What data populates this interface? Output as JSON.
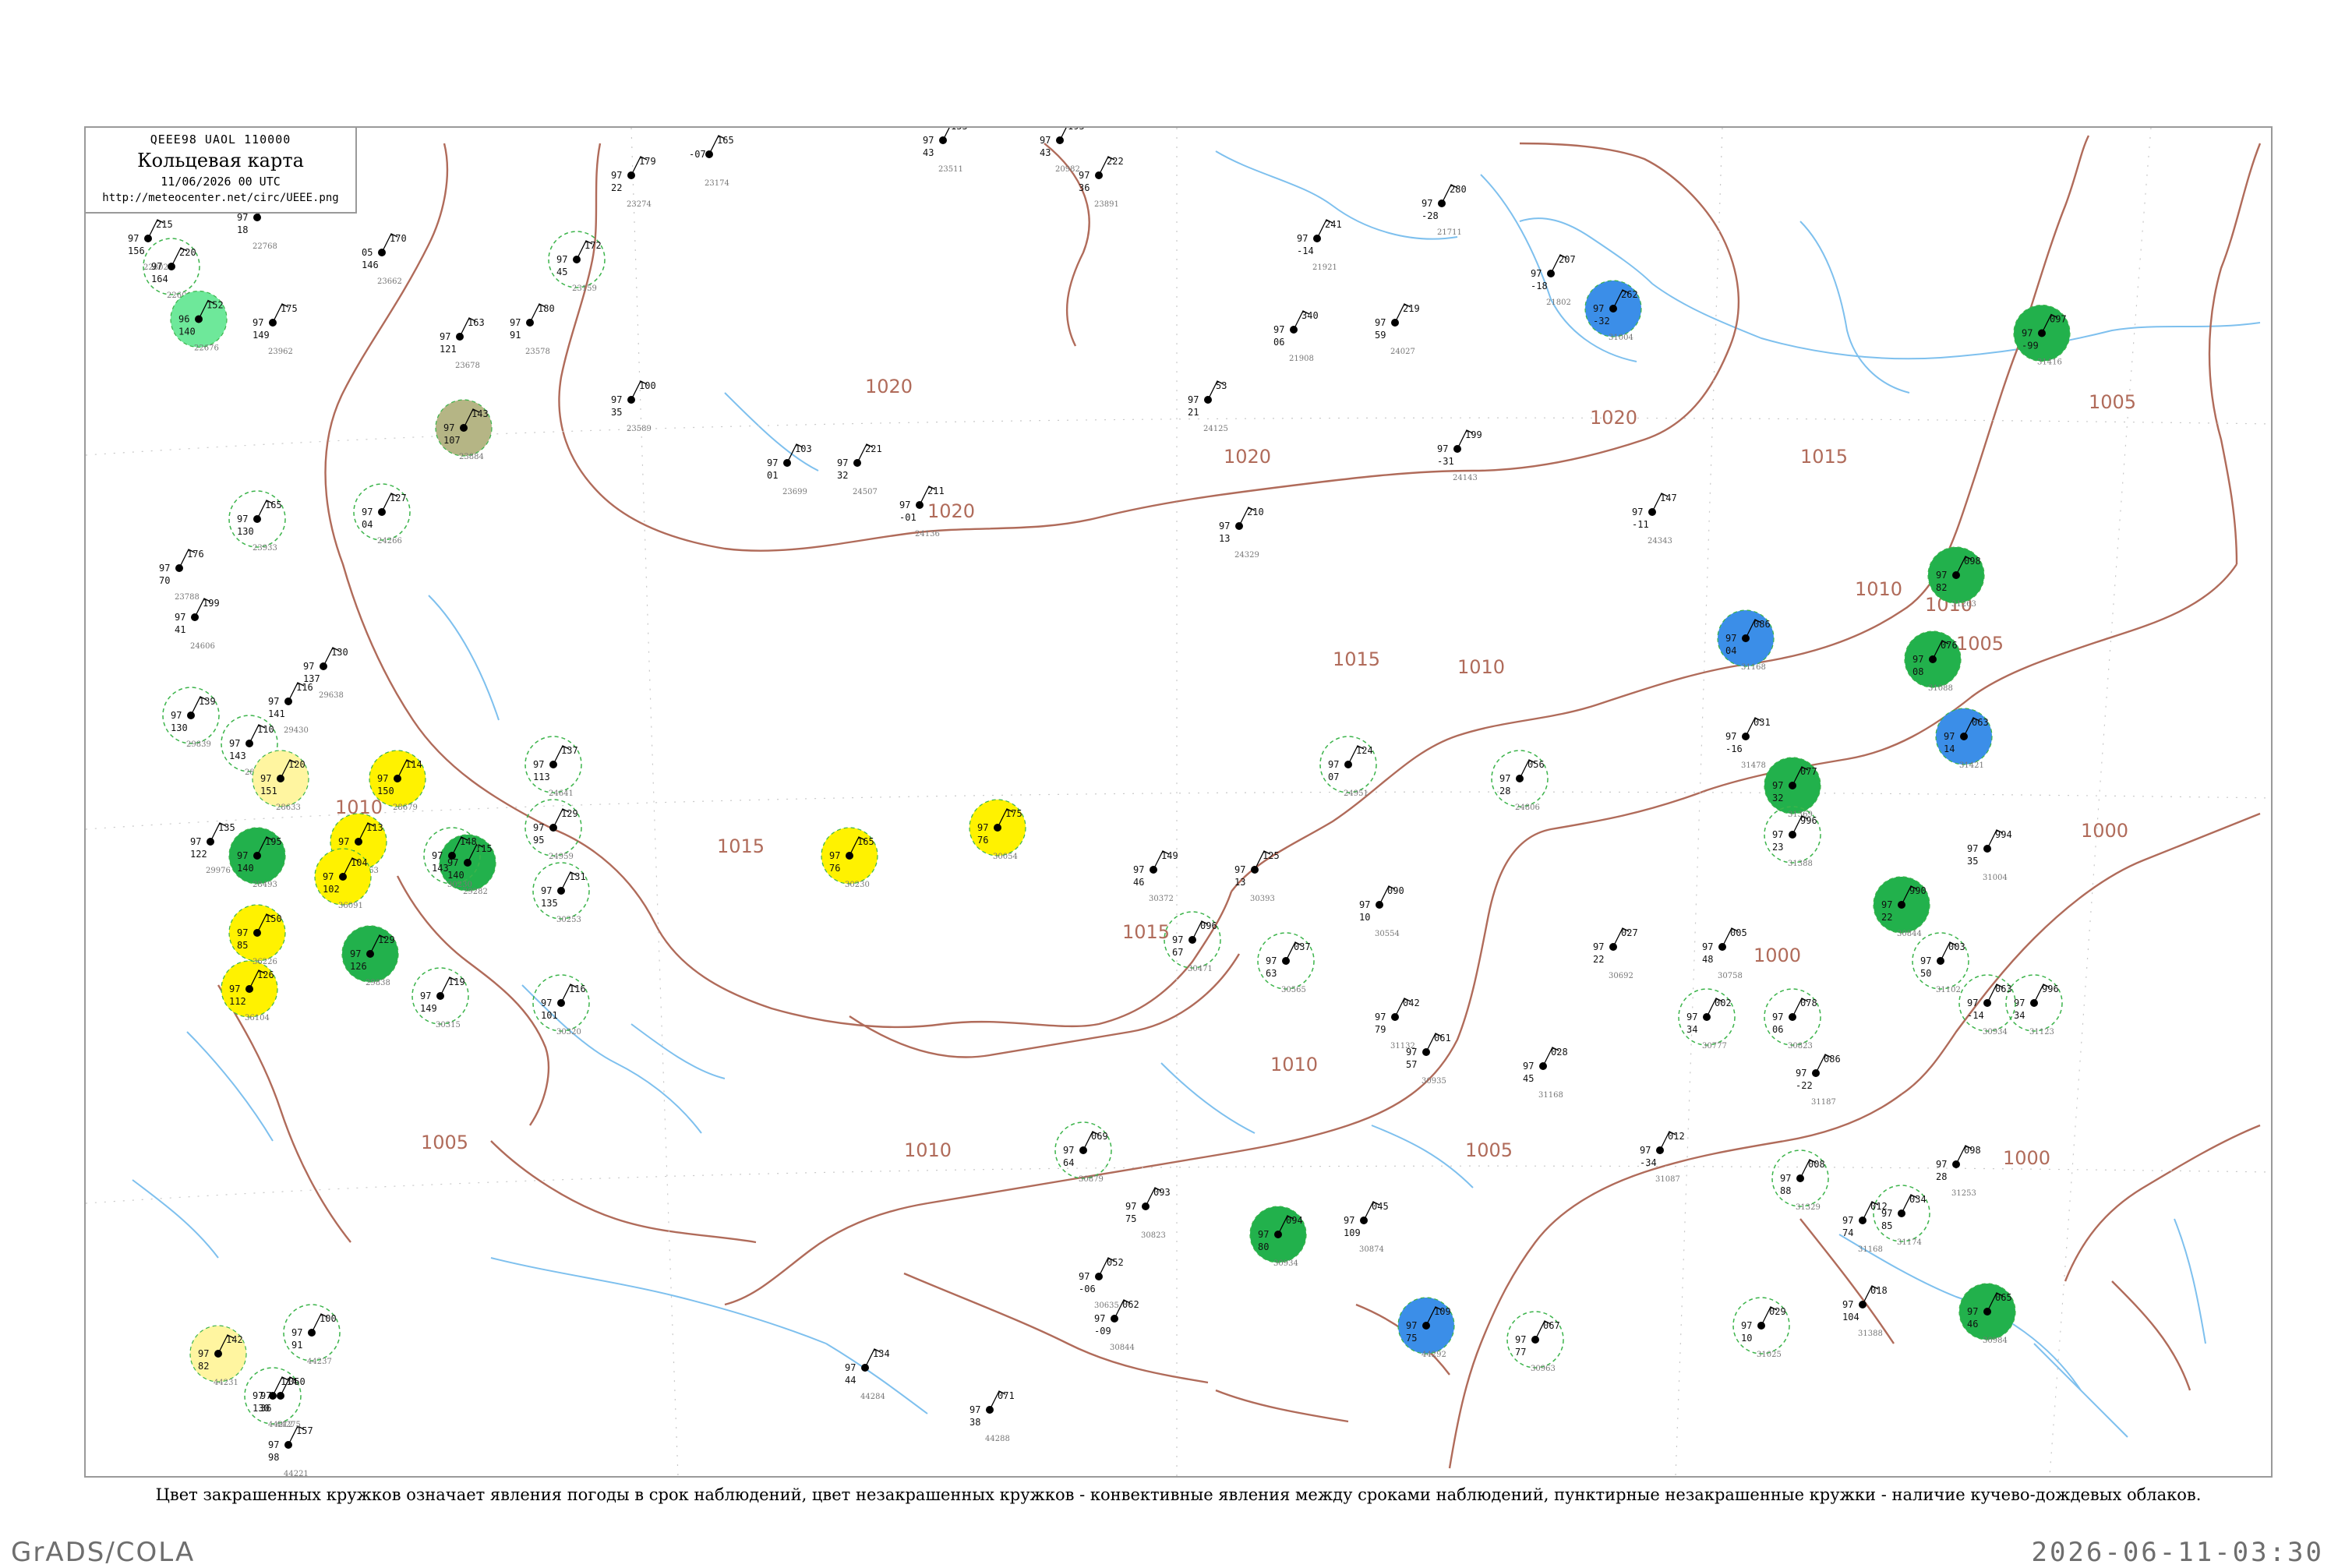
{
  "title_box": {
    "code": "QEEE98  UAOL  110000",
    "name": "Кольцевая карта",
    "time": "11/06/2026 00 UTC",
    "url": "http://meteocenter.net/circ/UEEE.png"
  },
  "caption": "Цвет закрашенных кружков означает явления погоды в срок наблюдений, цвет незакрашенных кружков - конвективные явления между сроками наблюдений, пунктирные незакрашенные кружки - наличие кучево-дождевых облаков.",
  "footer": {
    "left": "GrADS/COLA",
    "right": "2026-06-11-03:30"
  },
  "colors": {
    "isobar": "#b06b5a",
    "water": "#7ec0ee",
    "frame": "#9a9a9a",
    "green": "#22b14c",
    "light_green": "#6ee89a",
    "yellow": "#fff200",
    "pale_yellow": "#fff5a0",
    "blue": "#3b8ee8",
    "olive": "#b5b585",
    "dashed_ring": "#3cb44b"
  },
  "isobar_labels": [
    {
      "text": "1020"
    },
    {
      "text": "1020"
    },
    {
      "text": "1020"
    },
    {
      "text": "1020"
    },
    {
      "text": "1015"
    },
    {
      "text": "1015"
    },
    {
      "text": "1015"
    },
    {
      "text": "1015"
    },
    {
      "text": "1010"
    },
    {
      "text": "1010"
    },
    {
      "text": "1010"
    },
    {
      "text": "1010"
    },
    {
      "text": "1010"
    },
    {
      "text": "1010"
    },
    {
      "text": "1005"
    },
    {
      "text": "1005"
    },
    {
      "text": "1005"
    },
    {
      "text": "1000"
    },
    {
      "text": "1000"
    },
    {
      "text": "1000"
    },
    {
      "text": "1005"
    }
  ],
  "stations": [
    {
      "p": "155",
      "t": "97",
      "td": "43",
      "idx": "23511",
      "mark": "none"
    },
    {
      "p": "195",
      "t": "97",
      "td": "43",
      "idx": "20982",
      "mark": "none"
    },
    {
      "p": "165",
      "t": "-07",
      "td": "",
      "idx": "23174",
      "mark": "none"
    },
    {
      "p": "179",
      "t": "97",
      "td": "22",
      "idx": "23274",
      "mark": "none"
    },
    {
      "p": "222",
      "t": "97",
      "td": "36",
      "idx": "23891",
      "mark": "none"
    },
    {
      "p": "280",
      "t": "97",
      "td": "-28",
      "idx": "21711",
      "mark": "none"
    },
    {
      "p": "241",
      "t": "97",
      "td": "-14",
      "idx": "21921",
      "mark": "none"
    },
    {
      "p": "207",
      "t": "97",
      "td": "-18",
      "idx": "21802",
      "mark": "none"
    },
    {
      "p": "262",
      "t": "97",
      "td": "-32",
      "idx": "31004",
      "mark": "blue"
    },
    {
      "p": "206",
      "t": "97",
      "td": "18",
      "idx": "22768",
      "mark": "none"
    },
    {
      "p": "215",
      "t": "97",
      "td": "156",
      "idx": "22802",
      "mark": "none"
    },
    {
      "p": "220",
      "t": "97",
      "td": "164",
      "idx": "22601",
      "mark": "dashed"
    },
    {
      "p": "172",
      "t": "97",
      "td": "45",
      "idx": "23159",
      "mark": "dashed"
    },
    {
      "p": "170",
      "t": "05",
      "td": "146",
      "idx": "23662",
      "mark": "none"
    },
    {
      "p": "180",
      "t": "97",
      "td": "91",
      "idx": "23578",
      "mark": "none"
    },
    {
      "p": "163",
      "t": "97",
      "td": "121",
      "idx": "23678",
      "mark": "none"
    },
    {
      "p": "152",
      "t": "96",
      "td": "140",
      "idx": "22676",
      "mark": "light_green"
    },
    {
      "p": "175",
      "t": "97",
      "td": "149",
      "idx": "23962",
      "mark": "none"
    },
    {
      "p": "340",
      "t": "97",
      "td": "06",
      "idx": "21908",
      "mark": "none"
    },
    {
      "p": "219",
      "t": "97",
      "td": "59",
      "idx": "24027",
      "mark": "none"
    },
    {
      "p": "53",
      "t": "97",
      "td": "21",
      "idx": "24125",
      "mark": "none"
    },
    {
      "p": "199",
      "t": "97",
      "td": "-31",
      "idx": "24143",
      "mark": "none"
    },
    {
      "p": "143",
      "t": "97",
      "td": "107",
      "idx": "23884",
      "mark": "olive"
    },
    {
      "p": "100",
      "t": "97",
      "td": "35",
      "idx": "23589",
      "mark": "none"
    },
    {
      "p": "103",
      "t": "97",
      "td": "01",
      "idx": "23699",
      "mark": "none"
    },
    {
      "p": "221",
      "t": "97",
      "td": "32",
      "idx": "24507",
      "mark": "none"
    },
    {
      "p": "211",
      "t": "97",
      "td": "-01",
      "idx": "24136",
      "mark": "none"
    },
    {
      "p": "210",
      "t": "97",
      "td": "13",
      "idx": "24329",
      "mark": "none"
    },
    {
      "p": "147",
      "t": "97",
      "td": "-11",
      "idx": "24343",
      "mark": "none"
    },
    {
      "p": "127",
      "t": "97",
      "td": "04",
      "idx": "24266",
      "mark": "dashed"
    },
    {
      "p": "165",
      "t": "97",
      "td": "130",
      "idx": "23933",
      "mark": "dashed"
    },
    {
      "p": "176",
      "t": "97",
      "td": "70",
      "idx": "23788",
      "mark": "none"
    },
    {
      "p": "199",
      "t": "97",
      "td": "41",
      "idx": "24606",
      "mark": "none"
    },
    {
      "p": "116",
      "t": "97",
      "td": "141",
      "idx": "29430",
      "mark": "none"
    },
    {
      "p": "130",
      "t": "97",
      "td": "137",
      "idx": "29638",
      "mark": "none"
    },
    {
      "p": "139",
      "t": "97",
      "td": "130",
      "idx": "29839",
      "mark": "dashed"
    },
    {
      "p": "110",
      "t": "97",
      "td": "143",
      "idx": "28506",
      "mark": "dashed"
    },
    {
      "p": "120",
      "t": "97",
      "td": "151",
      "idx": "28633",
      "mark": "pale_yellow"
    },
    {
      "p": "114",
      "t": "97",
      "td": "150",
      "idx": "28679",
      "mark": "yellow"
    },
    {
      "p": "195",
      "t": "97",
      "td": "140",
      "idx": "28493",
      "mark": "green"
    },
    {
      "p": "113",
      "t": "97",
      "td": "137",
      "idx": "29263",
      "mark": "yellow"
    },
    {
      "p": "115",
      "t": "97",
      "td": "140",
      "idx": "29282",
      "mark": "green"
    },
    {
      "p": "137",
      "t": "97",
      "td": "113",
      "idx": "24641",
      "mark": "dashed"
    },
    {
      "p": "129",
      "t": "97",
      "td": "95",
      "idx": "24959",
      "mark": "dashed"
    },
    {
      "p": "124",
      "t": "97",
      "td": "07",
      "idx": "24951",
      "mark": "dashed"
    },
    {
      "p": "056",
      "t": "97",
      "td": "28",
      "idx": "24806",
      "mark": "dashed"
    },
    {
      "p": "097",
      "t": "97",
      "td": "-99",
      "idx": "31416",
      "mark": "green"
    },
    {
      "p": "098",
      "t": "97",
      "td": "82",
      "idx": "31263",
      "mark": "green"
    },
    {
      "p": "086",
      "t": "97",
      "td": "04",
      "idx": "31168",
      "mark": "blue"
    },
    {
      "p": "076",
      "t": "97",
      "td": "08",
      "idx": "31088",
      "mark": "green"
    },
    {
      "p": "063",
      "t": "97",
      "td": "14",
      "idx": "31421",
      "mark": "blue"
    },
    {
      "p": "031",
      "t": "97",
      "td": "-16",
      "idx": "31478",
      "mark": "none"
    },
    {
      "p": "077",
      "t": "97",
      "td": "32",
      "idx": "31369",
      "mark": "green"
    },
    {
      "p": "996",
      "t": "97",
      "td": "23",
      "idx": "31388",
      "mark": "dashed"
    },
    {
      "p": "175",
      "t": "97",
      "td": "76",
      "idx": "30054",
      "mark": "yellow"
    },
    {
      "p": "165",
      "t": "97",
      "td": "76",
      "idx": "30230",
      "mark": "yellow"
    },
    {
      "p": "135",
      "t": "97",
      "td": "122",
      "idx": "29976",
      "mark": "none"
    },
    {
      "p": "104",
      "t": "97",
      "td": "102",
      "idx": "36091",
      "mark": "yellow"
    },
    {
      "p": "129",
      "t": "97",
      "td": "126",
      "idx": "29838",
      "mark": "green"
    },
    {
      "p": "126",
      "t": "97",
      "td": "112",
      "idx": "36104",
      "mark": "yellow"
    },
    {
      "p": "150",
      "t": "97",
      "td": "85",
      "idx": "36226",
      "mark": "yellow"
    },
    {
      "p": "119",
      "t": "97",
      "td": "149",
      "idx": "30315",
      "mark": "dashed"
    },
    {
      "p": "148",
      "t": "97",
      "td": "143",
      "idx": "30230",
      "mark": "dashed"
    },
    {
      "p": "131",
      "t": "97",
      "td": "135",
      "idx": "30253",
      "mark": "dashed"
    },
    {
      "p": "116",
      "t": "97",
      "td": "101",
      "idx": "30320",
      "mark": "dashed"
    },
    {
      "p": "149",
      "t": "97",
      "td": "46",
      "idx": "30372",
      "mark": "none"
    },
    {
      "p": "125",
      "t": "97",
      "td": "13",
      "idx": "30393",
      "mark": "none"
    },
    {
      "p": "096",
      "t": "97",
      "td": "67",
      "idx": "30471",
      "mark": "dashed"
    },
    {
      "p": "037",
      "t": "97",
      "td": "63",
      "idx": "30565",
      "mark": "dashed"
    },
    {
      "p": "090",
      "t": "97",
      "td": "10",
      "idx": "30554",
      "mark": "none"
    },
    {
      "p": "027",
      "t": "97",
      "td": "22",
      "idx": "30692",
      "mark": "none"
    },
    {
      "p": "005",
      "t": "97",
      "td": "48",
      "idx": "30758",
      "mark": "none"
    },
    {
      "p": "990",
      "t": "97",
      "td": "22",
      "idx": "30844",
      "mark": "green"
    },
    {
      "p": "002",
      "t": "97",
      "td": "34",
      "idx": "30777",
      "mark": "dashed"
    },
    {
      "p": "994",
      "t": "97",
      "td": "35",
      "idx": "31004",
      "mark": "none"
    },
    {
      "p": "003",
      "t": "97",
      "td": "50",
      "idx": "31102",
      "mark": "dashed"
    },
    {
      "p": "996",
      "t": "97",
      "td": "34",
      "idx": "31123",
      "mark": "dashed"
    },
    {
      "p": "063",
      "t": "97",
      "td": "-14",
      "idx": "30934",
      "mark": "dashed"
    },
    {
      "p": "078",
      "t": "97",
      "td": "06",
      "idx": "30823",
      "mark": "dashed"
    },
    {
      "p": "061",
      "t": "97",
      "td": "57",
      "idx": "30935",
      "mark": "none"
    },
    {
      "p": "042",
      "t": "97",
      "td": "79",
      "idx": "31132",
      "mark": "none"
    },
    {
      "p": "028",
      "t": "97",
      "td": "45",
      "idx": "31168",
      "mark": "none"
    },
    {
      "p": "086",
      "t": "97",
      "td": "-22",
      "idx": "31187",
      "mark": "none"
    },
    {
      "p": "012",
      "t": "97",
      "td": "-34",
      "idx": "31087",
      "mark": "none"
    },
    {
      "p": "098",
      "t": "97",
      "td": "28",
      "idx": "31253",
      "mark": "none"
    },
    {
      "p": "034",
      "t": "97",
      "td": "85",
      "idx": "31174",
      "mark": "dashed"
    },
    {
      "p": "008",
      "t": "97",
      "td": "88",
      "idx": "31329",
      "mark": "dashed"
    },
    {
      "p": "012",
      "t": "97",
      "td": "74",
      "idx": "31168",
      "mark": "none"
    },
    {
      "p": "029",
      "t": "97",
      "td": "10",
      "idx": "31025",
      "mark": "dashed"
    },
    {
      "p": "018",
      "t": "97",
      "td": "104",
      "idx": "31388",
      "mark": "none"
    },
    {
      "p": "065",
      "t": "97",
      "td": "46",
      "idx": "30984",
      "mark": "green"
    },
    {
      "p": "067",
      "t": "97",
      "td": "77",
      "idx": "30963",
      "mark": "dashed"
    },
    {
      "p": "094",
      "t": "97",
      "td": "80",
      "idx": "30934",
      "mark": "green"
    },
    {
      "p": "069",
      "t": "97",
      "td": "64",
      "idx": "30879",
      "mark": "dashed"
    },
    {
      "p": "045",
      "t": "97",
      "td": "109",
      "idx": "30874",
      "mark": "none"
    },
    {
      "p": "093",
      "t": "97",
      "td": "75",
      "idx": "30823",
      "mark": "none"
    },
    {
      "p": "052",
      "t": "97",
      "td": "-06",
      "idx": "30635",
      "mark": "none"
    },
    {
      "p": "062",
      "t": "97",
      "td": "-09",
      "idx": "30844",
      "mark": "none"
    },
    {
      "p": "109",
      "t": "97",
      "td": "75",
      "idx": "44292",
      "mark": "blue"
    },
    {
      "p": "134",
      "t": "97",
      "td": "44",
      "idx": "44284",
      "mark": "none"
    },
    {
      "p": "071",
      "t": "97",
      "td": "38",
      "idx": "44288",
      "mark": "none"
    },
    {
      "p": "142",
      "t": "97",
      "td": "82",
      "idx": "44231",
      "mark": "pale_yellow"
    },
    {
      "p": "114",
      "t": "97",
      "td": "130",
      "idx": "44212",
      "mark": "dashed"
    },
    {
      "p": "157",
      "t": "97",
      "td": "98",
      "idx": "44221",
      "mark": "none"
    },
    {
      "p": "100",
      "t": "97",
      "td": "91",
      "idx": "44237",
      "mark": "dashed"
    },
    {
      "p": "060",
      "t": "97",
      "td": "36",
      "idx": "44275",
      "mark": "none"
    }
  ]
}
